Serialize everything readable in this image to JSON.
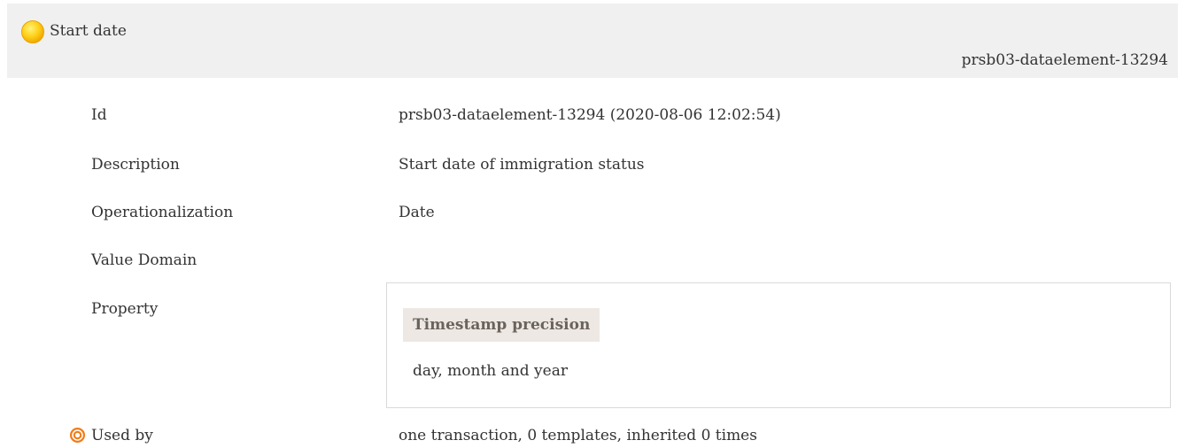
{
  "header": {
    "title": "Start date",
    "id": "prsb03-dataelement-13294",
    "icon": "status-circle-icon",
    "icon_color": "#f5c400"
  },
  "rows": {
    "id": {
      "label": "Id",
      "value": "prsb03-dataelement-13294 (2020-08-06 12:02:54)"
    },
    "description": {
      "label": "Description",
      "value": "Start date of immigration status"
    },
    "operationalization": {
      "label": "Operationalization",
      "value": "Date"
    },
    "value_domain": {
      "label": "Value Domain"
    },
    "property": {
      "label": "Property",
      "name": "Timestamp precision",
      "value": "day, month and year"
    },
    "used_by": {
      "label": "Used by",
      "icon": "target-icon",
      "icon_color": "#f07d1a",
      "value": "one transaction, 0 templates, inherited 0 times"
    }
  }
}
